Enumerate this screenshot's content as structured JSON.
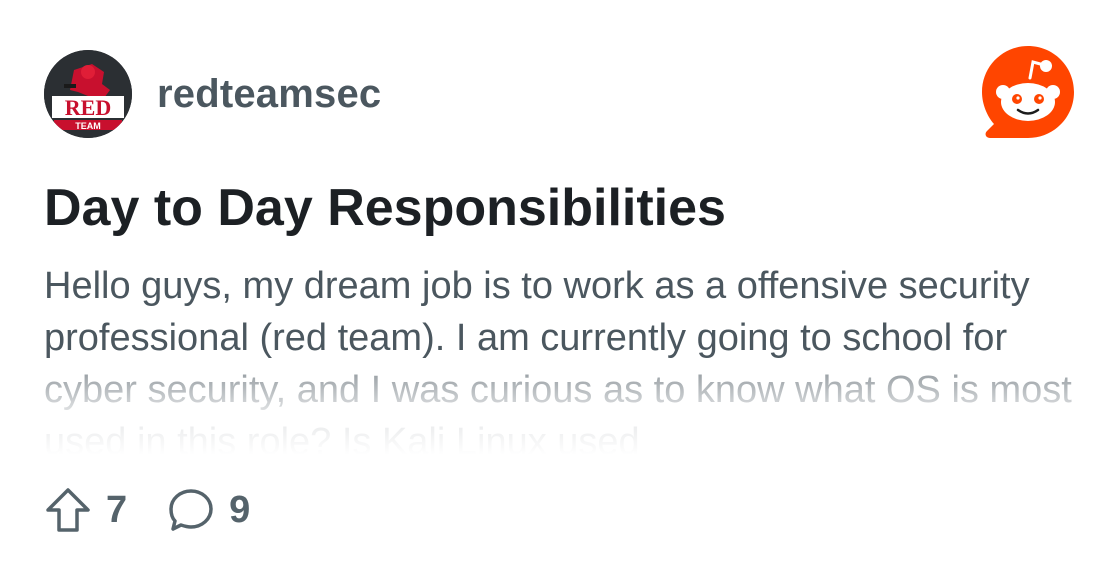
{
  "community": {
    "name": "redteamsec",
    "avatar_text": "RED",
    "avatar_subtext": "TEAM"
  },
  "post": {
    "title": "Day to Day Responsibilities",
    "body": "Hello guys, my dream job is to work as a offensive security professional (red team). I am currently going to school for cyber security, and I was curious as to know what OS is most used in this role? Is Kali Linux used"
  },
  "stats": {
    "upvotes": "7",
    "comments": "9"
  },
  "icons": {
    "upvote": "upvote-arrow-icon",
    "comment": "comment-bubble-icon",
    "brand": "reddit-logo-icon"
  },
  "colors": {
    "brand_orange": "#ff4500",
    "title": "#1c2024",
    "body_text": "#4b575f",
    "stat_text": "#55636b"
  }
}
